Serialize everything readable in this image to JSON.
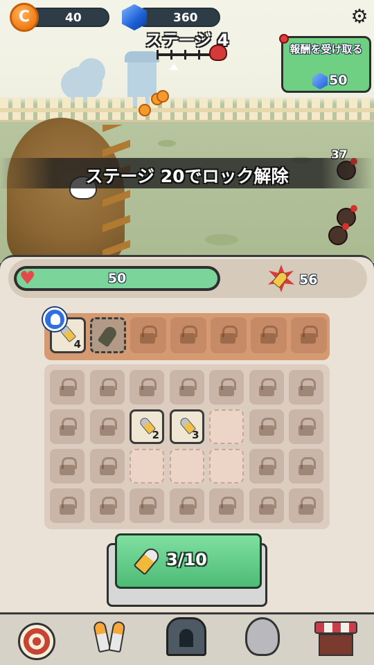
{
  "hud": {
    "coins": "40",
    "coin_symbol": "C",
    "gems": "360",
    "stage_title": "ステージ 4",
    "stage_progress": 0.25
  },
  "reward": {
    "title": "報酬を受け取る",
    "amount": "50"
  },
  "banner": {
    "text": "ステージ 20でロック解除"
  },
  "battle": {
    "damage_number": "37"
  },
  "stats": {
    "hp": "50",
    "ammo": "56"
  },
  "equipment": {
    "slots": [
      {
        "type": "bullet-item",
        "count": "4"
      },
      {
        "type": "rocket-empty",
        "count": ""
      },
      {
        "type": "locked"
      },
      {
        "type": "locked"
      },
      {
        "type": "locked"
      },
      {
        "type": "locked"
      },
      {
        "type": "locked"
      }
    ]
  },
  "inventory": {
    "rows": [
      [
        "locked",
        "locked",
        "locked",
        "locked",
        "locked",
        "locked",
        "locked"
      ],
      [
        "locked",
        "locked",
        "item:2",
        "item:3",
        "open",
        "locked",
        "locked"
      ],
      [
        "locked",
        "locked",
        "open",
        "open",
        "open",
        "locked",
        "locked"
      ],
      [
        "locked",
        "locked",
        "locked",
        "locked",
        "locked",
        "locked",
        "locked"
      ]
    ]
  },
  "fire_button": {
    "count": "3/10"
  },
  "nav": {
    "items": [
      {
        "icon": "target-icon"
      },
      {
        "icon": "bullets-icon"
      },
      {
        "icon": "furnace-icon"
      },
      {
        "icon": "bird-icon"
      },
      {
        "icon": "shop-icon"
      }
    ]
  },
  "colors": {
    "accent_green": "#6fcf83",
    "hp_green": "#7bd49a",
    "coin_orange": "#f07c15",
    "gem_blue": "#1d5fd6"
  }
}
